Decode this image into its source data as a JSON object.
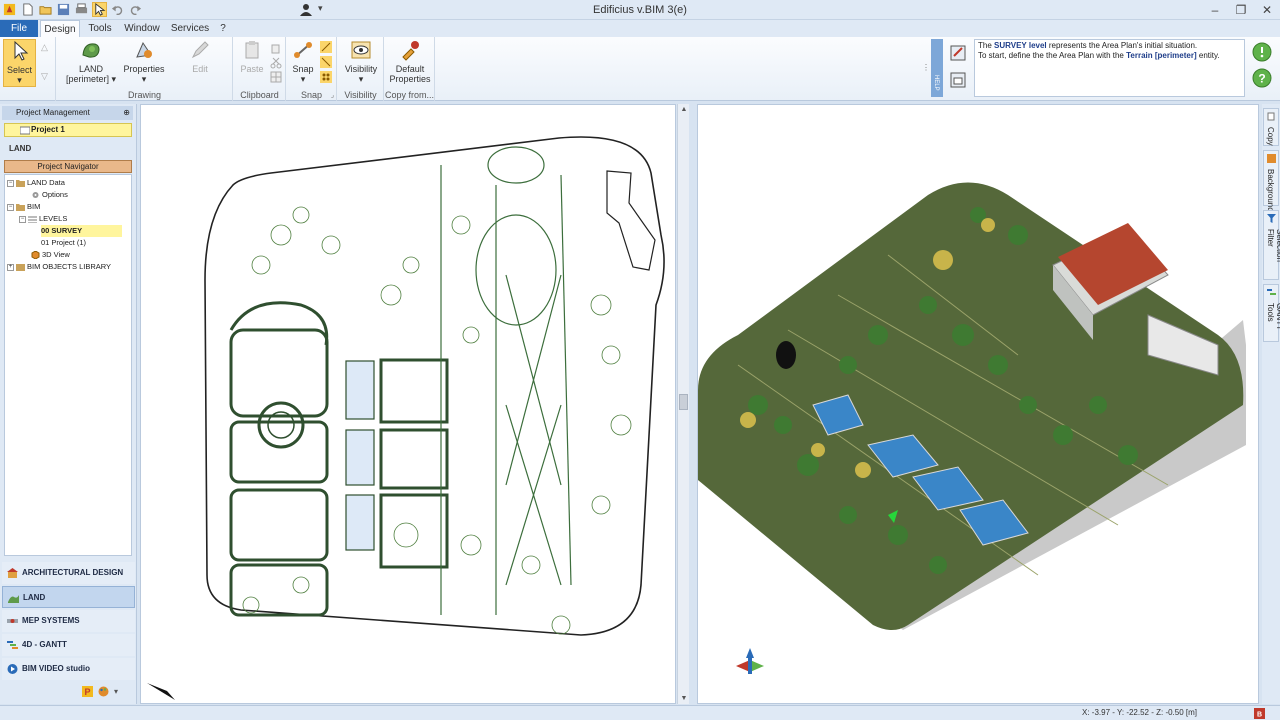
{
  "window": {
    "title": "Edificius v.BIM 3(e)"
  },
  "menu": {
    "tabs": [
      {
        "label": "File"
      },
      {
        "label": "Design"
      },
      {
        "label": "Tools"
      },
      {
        "label": "Window"
      },
      {
        "label": "Services"
      },
      {
        "label": "?"
      }
    ]
  },
  "ribbon": {
    "select": {
      "label": "Select"
    },
    "land": {
      "label": "LAND",
      "sub": "[perimeter]"
    },
    "properties": {
      "label": "Properties"
    },
    "edit": {
      "label": "Edit"
    },
    "drawing_group": "Drawing",
    "paste": {
      "label": "Paste"
    },
    "clipboard_group": "Clipboard",
    "snap": {
      "label": "Snap"
    },
    "snap_group": "Snap",
    "visibility": {
      "label": "Visibility"
    },
    "visibility_group": "Visibility",
    "default_props": {
      "label1": "Default",
      "label2": "Properties"
    },
    "copyfrom_group": "Copy from...",
    "help_tab": "HELP",
    "help_text": {
      "line1_pre": "The ",
      "line1_bold": "SURVEY level",
      "line1_post": " represents the Area Plan's initial situation.",
      "line2_pre": "To start, define the the Area Plan with the ",
      "line2_bold": "Terrain [perimeter]",
      "line2_post": " entity."
    }
  },
  "left_panel": {
    "header": "Project Management",
    "project": "Project 1",
    "section": "LAND",
    "navigator": "Project Navigator",
    "tree": {
      "land_data": "LAND Data",
      "options": "Options",
      "bim": "BIM",
      "levels": "LEVELS",
      "survey": "00 SURVEY",
      "project": "01 Project (1)",
      "view3d": "3D View",
      "library": "BIM OBJECTS LIBRARY"
    },
    "modules": [
      {
        "label": "ARCHITECTURAL DESIGN"
      },
      {
        "label": "LAND"
      },
      {
        "label": "MEP SYSTEMS"
      },
      {
        "label": "4D - GANTT"
      },
      {
        "label": "BIM VIDEO studio"
      }
    ]
  },
  "right_tabs": [
    {
      "label": "Copy"
    },
    {
      "label": "Background"
    },
    {
      "label": "Selection Filter"
    },
    {
      "label": "GANTT Tools"
    }
  ],
  "status": {
    "coords": "X: -3.97 - Y: -22.52 - Z: -0.50 [m]"
  },
  "colors": {
    "accent": "#2a6bb8",
    "highlight": "#fff59d",
    "ribbon_bg": "#e9f0f8"
  }
}
